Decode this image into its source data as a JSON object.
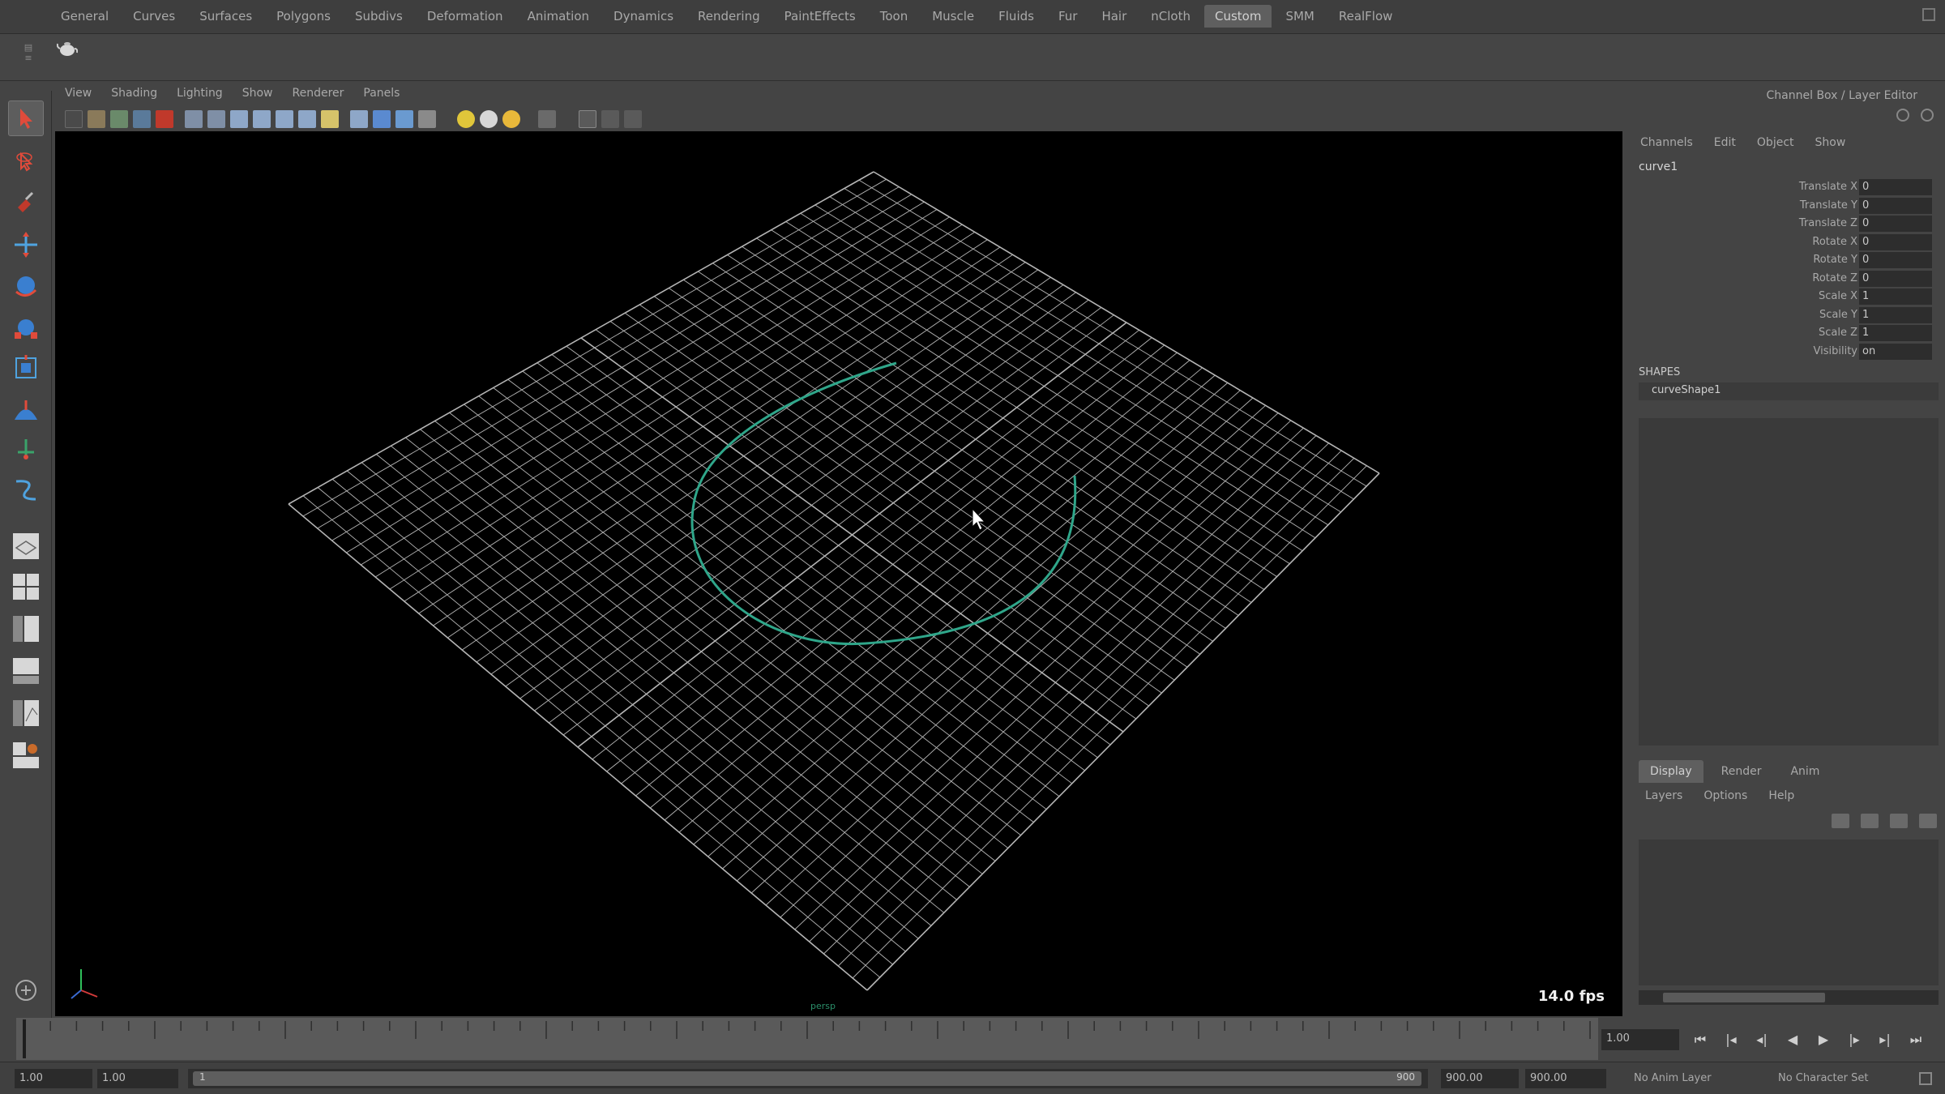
{
  "shelf": {
    "tabs": [
      "General",
      "Curves",
      "Surfaces",
      "Polygons",
      "Subdivs",
      "Deformation",
      "Animation",
      "Dynamics",
      "Rendering",
      "PaintEffects",
      "Toon",
      "Muscle",
      "Fluids",
      "Fur",
      "Hair",
      "nCloth",
      "Custom",
      "SMM",
      "RealFlow"
    ],
    "active_tab": "Custom"
  },
  "panel": {
    "menus": [
      "View",
      "Shading",
      "Lighting",
      "Show",
      "Renderer",
      "Panels"
    ]
  },
  "viewport": {
    "fps": "14.0 fps",
    "camera_label": "persp",
    "curve_color": "#2fa68a",
    "grid_color": "#b5b5b5"
  },
  "channel_box": {
    "title": "Channel Box / Layer Editor",
    "menus": [
      "Channels",
      "Edit",
      "Object",
      "Show"
    ],
    "object": "curve1",
    "attributes": [
      {
        "name": "Translate X",
        "value": "0"
      },
      {
        "name": "Translate Y",
        "value": "0"
      },
      {
        "name": "Translate Z",
        "value": "0"
      },
      {
        "name": "Rotate X",
        "value": "0"
      },
      {
        "name": "Rotate Y",
        "value": "0"
      },
      {
        "name": "Rotate Z",
        "value": "0"
      },
      {
        "name": "Scale X",
        "value": "1"
      },
      {
        "name": "Scale Y",
        "value": "1"
      },
      {
        "name": "Scale Z",
        "value": "1"
      },
      {
        "name": "Visibility",
        "value": "on"
      }
    ],
    "shapes_header": "SHAPES",
    "shape": "curveShape1"
  },
  "layer_editor": {
    "tabs": [
      "Display",
      "Render",
      "Anim"
    ],
    "active_tab": "Display",
    "menus": [
      "Layers",
      "Options",
      "Help"
    ]
  },
  "timeline": {
    "current_time": "1.00",
    "range_start_outer": "1.00",
    "range_start_inner": "1.00",
    "slider_lo": "1",
    "slider_hi": "900",
    "range_end_inner": "900.00",
    "range_end_outer": "900.00",
    "anim_layer": "No Anim Layer",
    "character_set": "No Character Set"
  }
}
